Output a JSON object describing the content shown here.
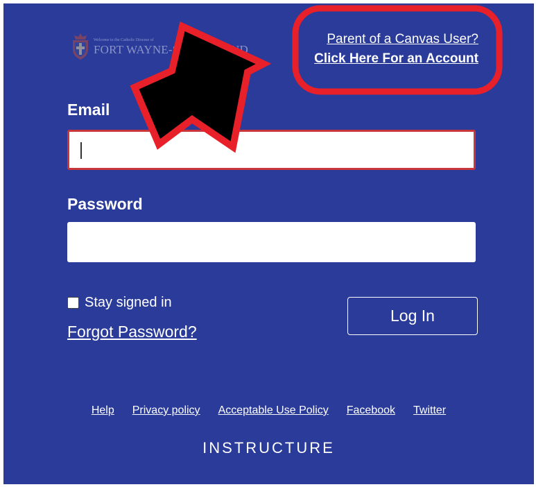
{
  "logo": {
    "small_text": "Welcome to the Catholic Diocese of",
    "big_text": "FORT WAYNE-SOUTH BEND"
  },
  "parent": {
    "line1": "Parent of a Canvas User?",
    "line2": "Click Here For an Account"
  },
  "form": {
    "email_label": "Email",
    "email_value": "",
    "password_label": "Password",
    "password_value": "",
    "stay_signed_in_label": "Stay signed in",
    "forgot_password": "Forgot Password?",
    "login_button": "Log In"
  },
  "footer": {
    "links": [
      "Help",
      "Privacy policy",
      "Acceptable Use Policy",
      "Facebook",
      "Twitter"
    ],
    "brand": "INSTRUCTURE"
  },
  "annotation": {
    "arrow_color": "#e8202a",
    "highlight_color": "#e8202a"
  },
  "colors": {
    "background": "#2a3b99",
    "focus_border": "#c8363c"
  }
}
